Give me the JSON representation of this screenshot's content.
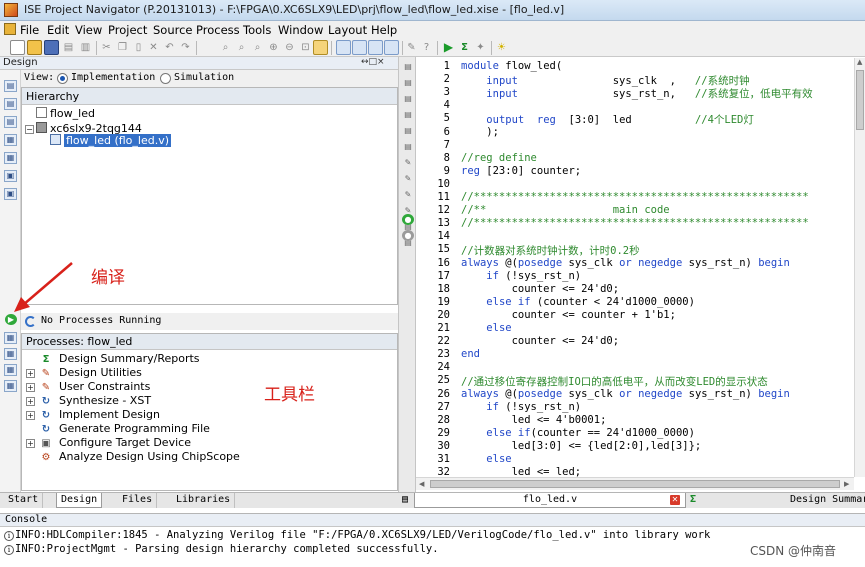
{
  "window": {
    "title": "ISE Project Navigator (P.20131013) - F:\\FPGA\\0.XC6SLX9\\LED\\prj\\flow_led\\flow_led.xise - [flo_led.v]"
  },
  "menu": [
    "File",
    "Edit",
    "View",
    "Project",
    "Source",
    "Process",
    "Tools",
    "Window",
    "Layout",
    "Help"
  ],
  "design_panel": {
    "title": "Design",
    "header_controls": "↔□×",
    "view_label": "View:",
    "implementation_label": "Implementation",
    "simulation_label": "Simulation",
    "hierarchy_title": "Hierarchy",
    "tree": [
      "flow_led",
      "xc6slx9-2tqg144",
      "flow_led (flo_led.v)"
    ],
    "process_status": "No Processes Running",
    "processes_title": "Processes: flow_led",
    "processes": [
      "Design Summary/Reports",
      "Design Utilities",
      "User Constraints",
      "Synthesize - XST",
      "Implement Design",
      "Generate Programming File",
      "Configure Target Device",
      "Analyze Design Using ChipScope"
    ],
    "tabs": [
      "Start",
      "Design",
      "Files",
      "Libraries"
    ]
  },
  "annotations": {
    "compile": "编译",
    "toolbar": "工具栏"
  },
  "colors": {
    "annotation_red": "#d8211a",
    "keyword_blue": "#2147c8",
    "comment_green": "#2f8a2f",
    "selection_blue": "#3470c8"
  },
  "editor": {
    "lines": [
      {
        "n": "1",
        "code": "module flow_led("
      },
      {
        "n": "2",
        "code": "    input               sys_clk  ,   //系统时钟"
      },
      {
        "n": "3",
        "code": "    input               sys_rst_n,   //系统复位，低电平有效"
      },
      {
        "n": "4",
        "code": ""
      },
      {
        "n": "5",
        "code": "    output  reg  [3:0]  led          //4个LED灯"
      },
      {
        "n": "6",
        "code": "    );"
      },
      {
        "n": "7",
        "code": ""
      },
      {
        "n": "8",
        "code": "//reg define"
      },
      {
        "n": "9",
        "code": "reg [23:0] counter;"
      },
      {
        "n": "10",
        "code": ""
      },
      {
        "n": "11",
        "code": "//*****************************************************"
      },
      {
        "n": "12",
        "code": "//**                    main code"
      },
      {
        "n": "13",
        "code": "//*****************************************************"
      },
      {
        "n": "14",
        "code": ""
      },
      {
        "n": "15",
        "code": "//计数器对系统时钟计数，计时0.2秒"
      },
      {
        "n": "16",
        "code": "always @(posedge sys_clk or negedge sys_rst_n) begin"
      },
      {
        "n": "17",
        "code": "    if (!sys_rst_n)"
      },
      {
        "n": "18",
        "code": "        counter <= 24'd0;"
      },
      {
        "n": "19",
        "code": "    else if (counter < 24'd1000_0000)"
      },
      {
        "n": "20",
        "code": "        counter <= counter + 1'b1;"
      },
      {
        "n": "21",
        "code": "    else"
      },
      {
        "n": "22",
        "code": "        counter <= 24'd0;"
      },
      {
        "n": "23",
        "code": "end"
      },
      {
        "n": "24",
        "code": ""
      },
      {
        "n": "25",
        "code": "//通过移位寄存器控制IO口的高低电平，从而改变LED的显示状态"
      },
      {
        "n": "26",
        "code": "always @(posedge sys_clk or negedge sys_rst_n) begin"
      },
      {
        "n": "27",
        "code": "    if (!sys_rst_n)"
      },
      {
        "n": "28",
        "code": "        led <= 4'b0001;"
      },
      {
        "n": "29",
        "code": "    else if(counter == 24'd1000_0000)"
      },
      {
        "n": "30",
        "code": "        led[3:0] <= {led[2:0],led[3]};"
      },
      {
        "n": "31",
        "code": "    else"
      },
      {
        "n": "32",
        "code": "        led <= led;"
      }
    ],
    "tab_file": "flo_led.v",
    "tab_summary": "Design Summar"
  },
  "console": {
    "title": "Console",
    "lines": [
      "INFO:HDLCompiler:1845 - Analyzing Verilog file \"F:/FPGA/0.XC6SLX9/LED/VerilogCode/flo_led.v\" into library work",
      "INFO:ProjectMgmt - Parsing design hierarchy completed successfully."
    ]
  },
  "watermark": "CSDN @仲南音"
}
